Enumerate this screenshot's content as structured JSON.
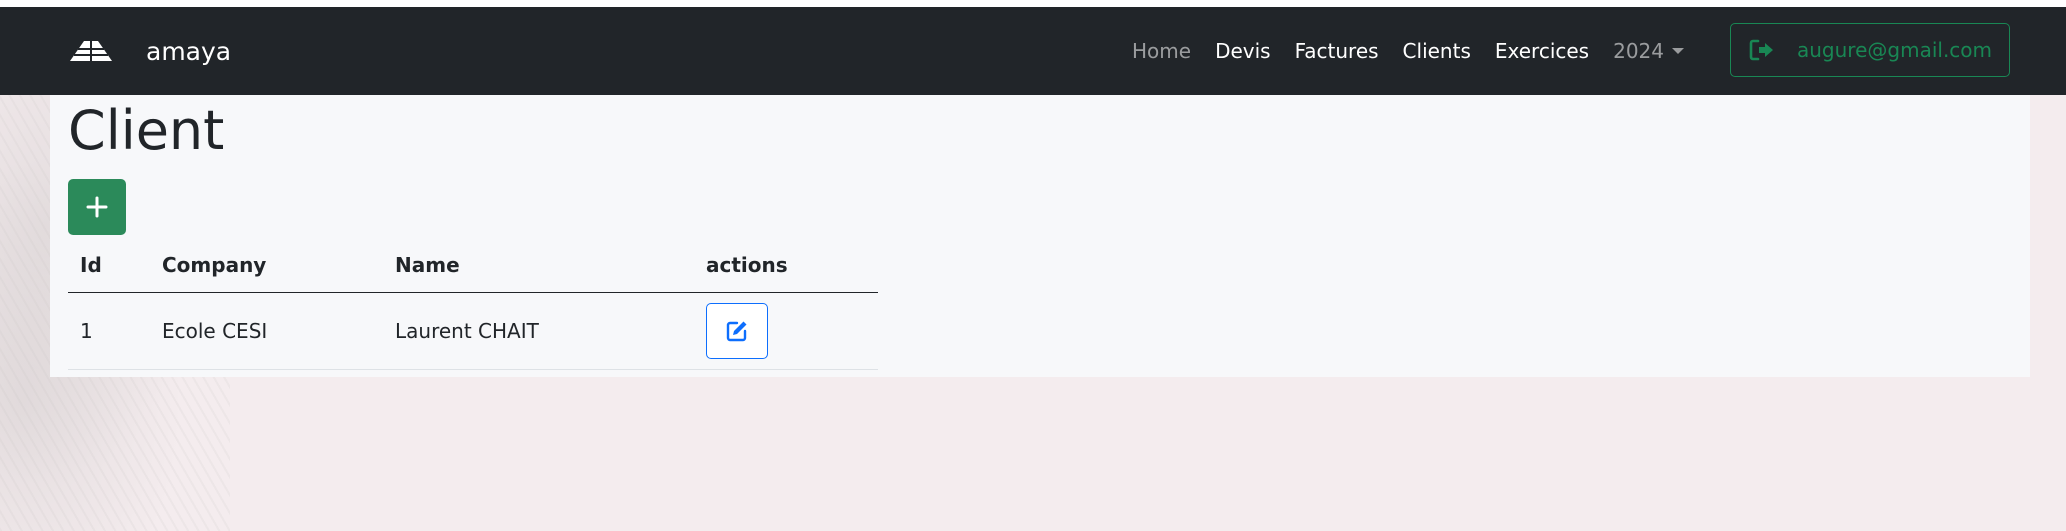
{
  "navbar": {
    "brand_name": "amaya",
    "links": {
      "home": "Home",
      "devis": "Devis",
      "factures": "Factures",
      "clients": "Clients",
      "exercices": "Exercices"
    },
    "year_dropdown": "2024",
    "user_email": "augure@gmail.com",
    "logout_icon": "sign-out-icon"
  },
  "page": {
    "title": "Client",
    "add_button_icon": "plus-icon"
  },
  "table": {
    "headers": {
      "id": "Id",
      "company": "Company",
      "name": "Name",
      "actions": "actions"
    },
    "rows": [
      {
        "id": "1",
        "company": "Ecole CESI",
        "name": "Laurent CHAIT",
        "action_icon": "edit-icon"
      }
    ]
  },
  "colors": {
    "navbar_bg": "#212529",
    "success": "#198754",
    "primary": "#0d6efd"
  }
}
